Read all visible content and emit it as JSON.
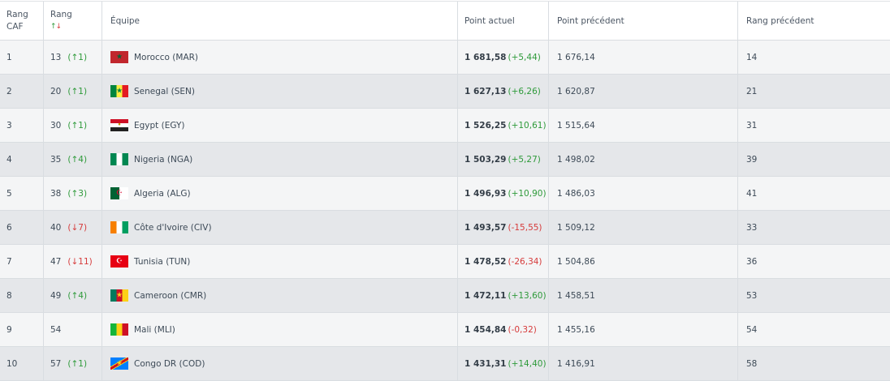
{
  "headers": {
    "rang_caf": [
      "Rang",
      "CAF"
    ],
    "rang": "Rang",
    "rang_sort_up": "↑",
    "rang_sort_down": "↓",
    "equipe": "Équipe",
    "point_actuel": "Point actuel",
    "point_precedent": "Point précédent",
    "rang_precedent": "Rang précédent"
  },
  "rows": [
    {
      "caf": "1",
      "rank": "13",
      "trend": "(↑1)",
      "dir": "up",
      "flag_icon": "morocco-flag-icon",
      "team": "Morocco (MAR)",
      "points": "1 681,58",
      "delta": "(+5,44)",
      "delta_dir": "up",
      "prev_points": "1 676,14",
      "prev_rank": "14"
    },
    {
      "caf": "2",
      "rank": "20",
      "trend": "(↑1)",
      "dir": "up",
      "flag_icon": "senegal-flag-icon",
      "team": "Senegal (SEN)",
      "points": "1 627,13",
      "delta": "(+6,26)",
      "delta_dir": "up",
      "prev_points": "1 620,87",
      "prev_rank": "21"
    },
    {
      "caf": "3",
      "rank": "30",
      "trend": "(↑1)",
      "dir": "up",
      "flag_icon": "egypt-flag-icon",
      "team": "Egypt (EGY)",
      "points": "1 526,25",
      "delta": "(+10,61)",
      "delta_dir": "up",
      "prev_points": "1 515,64",
      "prev_rank": "31"
    },
    {
      "caf": "4",
      "rank": "35",
      "trend": "(↑4)",
      "dir": "up",
      "flag_icon": "nigeria-flag-icon",
      "team": "Nigeria (NGA)",
      "points": "1 503,29",
      "delta": "(+5,27)",
      "delta_dir": "up",
      "prev_points": "1 498,02",
      "prev_rank": "39"
    },
    {
      "caf": "5",
      "rank": "38",
      "trend": "(↑3)",
      "dir": "up",
      "flag_icon": "algeria-flag-icon",
      "team": "Algeria (ALG)",
      "points": "1 496,93",
      "delta": "(+10,90)",
      "delta_dir": "up",
      "prev_points": "1 486,03",
      "prev_rank": "41"
    },
    {
      "caf": "6",
      "rank": "40",
      "trend": "(↓7)",
      "dir": "down",
      "flag_icon": "cote-divoire-flag-icon",
      "team": "Côte d'Ivoire (CIV)",
      "points": "1 493,57",
      "delta": "(-15,55)",
      "delta_dir": "down",
      "prev_points": "1 509,12",
      "prev_rank": "33"
    },
    {
      "caf": "7",
      "rank": "47",
      "trend": "(↓11)",
      "dir": "down",
      "flag_icon": "tunisia-flag-icon",
      "team": "Tunisia (TUN)",
      "points": "1 478,52",
      "delta": "(-26,34)",
      "delta_dir": "down",
      "prev_points": "1 504,86",
      "prev_rank": "36"
    },
    {
      "caf": "8",
      "rank": "49",
      "trend": "(↑4)",
      "dir": "up",
      "flag_icon": "cameroon-flag-icon",
      "team": "Cameroon (CMR)",
      "points": "1 472,11",
      "delta": "(+13,60)",
      "delta_dir": "up",
      "prev_points": "1 458,51",
      "prev_rank": "53"
    },
    {
      "caf": "9",
      "rank": "54",
      "trend": "",
      "dir": "none",
      "flag_icon": "mali-flag-icon",
      "team": "Mali (MLI)",
      "points": "1 454,84",
      "delta": "(-0,32)",
      "delta_dir": "down",
      "prev_points": "1 455,16",
      "prev_rank": "54"
    },
    {
      "caf": "10",
      "rank": "57",
      "trend": "(↑1)",
      "dir": "up",
      "flag_icon": "congo-dr-flag-icon",
      "team": "Congo DR (COD)",
      "points": "1 431,31",
      "delta": "(+14,40)",
      "delta_dir": "up",
      "prev_points": "1 416,91",
      "prev_rank": "58"
    }
  ],
  "colors": {
    "up": "#2e9a3a",
    "down": "#d63b3b",
    "row_light": "#f4f5f6",
    "row_dark": "#e5e7ea"
  }
}
